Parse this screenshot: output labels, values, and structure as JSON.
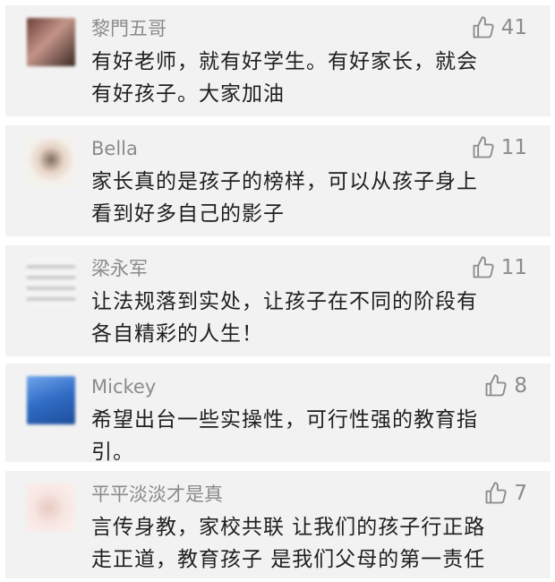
{
  "comments": [
    {
      "name": "黎門五哥",
      "likes": "41",
      "lines": [
        "有好老师，就有好学生。有好家长，就会",
        "有好孩子。大家加油"
      ],
      "avatar_colors": [
        "#6b3f38",
        "#c49488",
        "#3a2a24"
      ]
    },
    {
      "name": "Bella",
      "likes": "11",
      "lines": [
        "家长真的是孩子的榜样，可以从孩子身上",
        "看到好多自己的影子"
      ],
      "avatar_colors": [
        "#f4f1ec",
        "#7c6a5e",
        "#e7d3c4"
      ]
    },
    {
      "name": "梁永军",
      "likes": "11",
      "lines": [
        "让法规落到实处，让孩子在不同的阶段有",
        "各自精彩的人生！"
      ],
      "avatar_colors": [
        "#f5f5f5",
        "#c9c9c9",
        "#9e9e9e"
      ]
    },
    {
      "name": "Mickey",
      "likes": "8",
      "lines": [
        "希望出台一些实操性，可行性强的教育指",
        "引。"
      ],
      "avatar_colors": [
        "#2f6bc4",
        "#6fa4ea",
        "#1f4e9a"
      ]
    },
    {
      "name": "平平淡淡才是真",
      "likes": "7",
      "lines": [
        "言传身教，家校共联 让我们的孩子行正路",
        "走正道，教育孩子 是我们父母的第一责任"
      ],
      "avatar_colors": [
        "#f7e6e2",
        "#e8c9c2",
        "#fbf1ee"
      ]
    }
  ]
}
